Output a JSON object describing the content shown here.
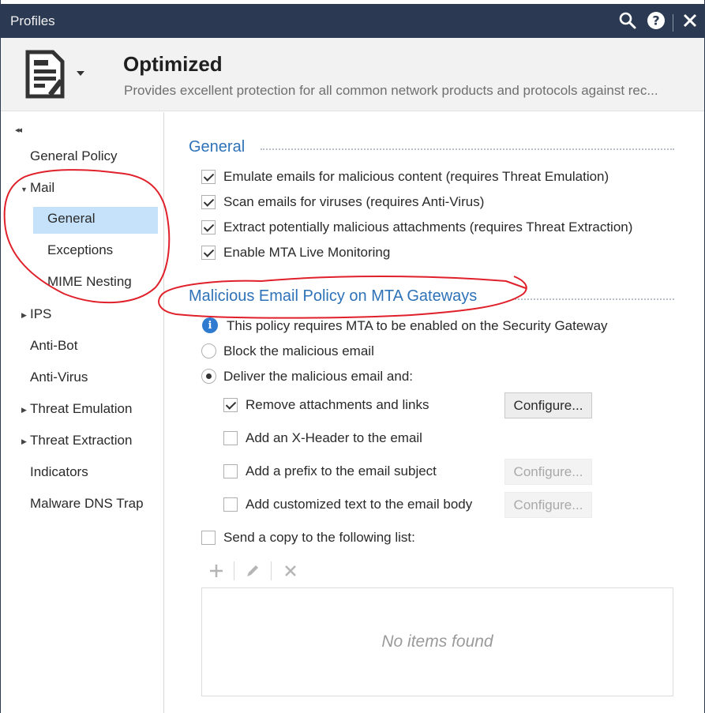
{
  "window": {
    "title": "Profiles",
    "icons": [
      "search-icon",
      "help-icon",
      "close-icon"
    ]
  },
  "header": {
    "profile_name": "Optimized",
    "description": "Provides excellent protection for all common network products and protocols against rec...",
    "icon": "profile-document-icon"
  },
  "sidebar": {
    "collapse_label": "◂◂",
    "items": [
      {
        "label": "General Policy"
      },
      {
        "label": "Mail",
        "expanded": true
      },
      {
        "label": "General",
        "selected": true
      },
      {
        "label": "Exceptions"
      },
      {
        "label": "MIME Nesting"
      },
      {
        "label": "IPS",
        "expandable": true
      },
      {
        "label": "Anti-Bot"
      },
      {
        "label": "Anti-Virus"
      },
      {
        "label": "Threat Emulation",
        "expandable": true
      },
      {
        "label": "Threat Extraction",
        "expandable": true
      },
      {
        "label": "Indicators"
      },
      {
        "label": "Malware DNS Trap"
      }
    ]
  },
  "general_section": {
    "title": "General",
    "options": [
      {
        "label": "Emulate emails for malicious content (requires Threat Emulation)",
        "checked": true
      },
      {
        "label": "Scan emails for viruses (requires Anti-Virus)",
        "checked": true
      },
      {
        "label": "Extract potentially malicious attachments (requires Threat Extraction)",
        "checked": true
      },
      {
        "label": "Enable MTA Live Monitoring",
        "checked": true
      }
    ]
  },
  "mta_section": {
    "title": "Malicious Email Policy on MTA Gateways",
    "info": "This policy requires MTA to be enabled on the Security Gateway",
    "radios": [
      {
        "label": "Block the malicious email",
        "selected": false
      },
      {
        "label": "Deliver the malicious email and:",
        "selected": true
      }
    ],
    "actions": [
      {
        "label": "Remove attachments and links",
        "checked": true,
        "button": "Configure...",
        "button_enabled": true
      },
      {
        "label": "Add an X-Header to the email",
        "checked": false
      },
      {
        "label": "Add a prefix to the email subject",
        "checked": false,
        "button": "Configure...",
        "button_enabled": false
      },
      {
        "label": "Add customized text to the email body",
        "checked": false,
        "button": "Configure...",
        "button_enabled": false
      }
    ],
    "send_copy": {
      "label": "Send a copy to the following list:",
      "checked": false
    },
    "list_toolbar": [
      "add-icon",
      "edit-icon",
      "delete-icon"
    ],
    "empty_message": "No items found"
  },
  "colors": {
    "titlebar": "#2b3a52",
    "accent": "#2e72b8",
    "selected": "#c6e2fa",
    "annotation": "#e0202a"
  }
}
